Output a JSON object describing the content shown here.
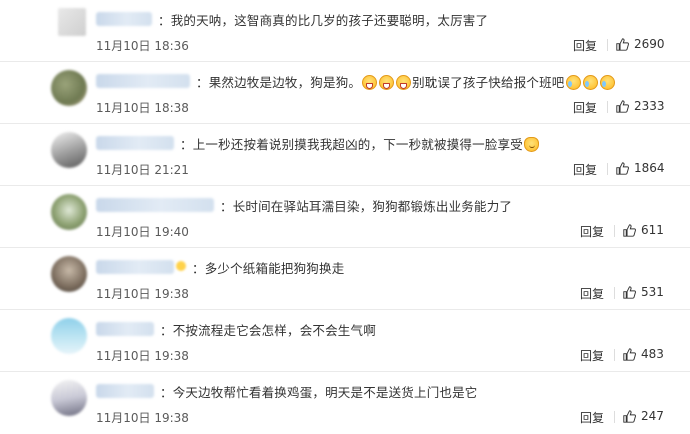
{
  "comments": [
    {
      "text": "：我的天呐，这智商真的比几岁的孩子还要聪明，太厉害了",
      "time": "11月10日 18:36",
      "reply_label": "回复",
      "likes": "2690",
      "emojis": []
    },
    {
      "text": "：果然边牧是边牧，狗是狗。",
      "text2": "别耽误了孩子快给报个班吧",
      "time": "11月10日 18:38",
      "reply_label": "回复",
      "likes": "2333",
      "emojis": [
        "laugh-emoji",
        "laugh-emoji",
        "laugh-emoji",
        "cry-laugh-emoji",
        "cry-laugh-emoji",
        "cry-laugh-emoji"
      ]
    },
    {
      "text": "：上一秒还按着说别摸我我超凶的，下一秒就被摸得一脸享受",
      "time": "11月10日 21:21",
      "reply_label": "回复",
      "likes": "1864",
      "emojis": [
        "cat-emoji"
      ]
    },
    {
      "text": "：长时间在驿站耳濡目染，狗狗都锻炼出业务能力了",
      "time": "11月10日 19:40",
      "reply_label": "回复",
      "likes": "611",
      "emojis": []
    },
    {
      "text": "：多少个纸箱能把狗狗换走",
      "time": "11月10日 19:38",
      "reply_label": "回复",
      "likes": "531",
      "emojis": []
    },
    {
      "text": "：不按流程走它会怎样，会不会生气啊",
      "time": "11月10日 19:38",
      "reply_label": "回复",
      "likes": "483",
      "emojis": []
    },
    {
      "text": "：今天边牧帮忙看着换鸡蛋，明天是不是送货上门也是它",
      "time": "11月10日 19:38",
      "reply_label": "回复",
      "likes": "247",
      "emojis": []
    }
  ],
  "colors": {
    "username_blur": "#c9d8ea",
    "divider": "#eaeaea",
    "text": "#333333",
    "time": "#5a5a5a"
  },
  "icons": {
    "like": "thumbs-up-icon"
  }
}
